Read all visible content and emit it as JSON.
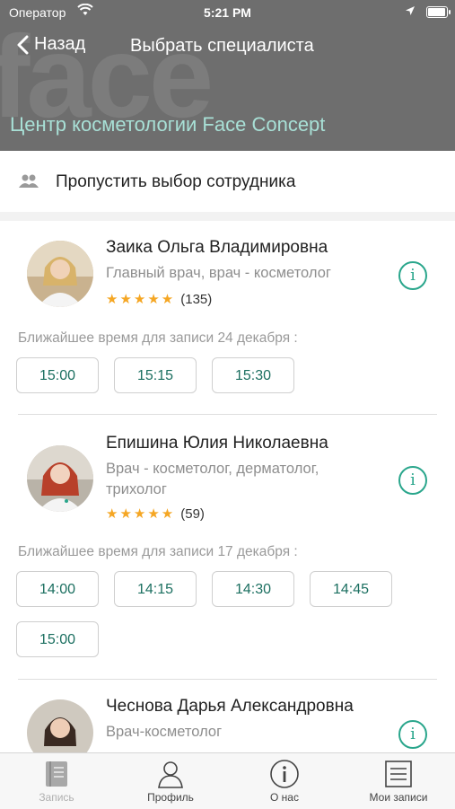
{
  "status_bar": {
    "carrier": "Оператор",
    "time": "5:21 PM"
  },
  "nav": {
    "back_label": "Назад",
    "title": "Выбрать специалиста"
  },
  "organization": {
    "name": "Центр косметологии Face Concept",
    "watermark": "face"
  },
  "skip": {
    "label": "Пропустить выбор сотрудника"
  },
  "specialists": [
    {
      "name": "Заика Ольга Владимировна",
      "role_lines": [
        "Главный врач, врач - косметолог"
      ],
      "stars": "★★★★★",
      "reviews": "(135)",
      "nearest_label": "Ближайшее время для записи 24 декабря :",
      "slots": [
        "15:00",
        "15:15",
        "15:30"
      ]
    },
    {
      "name": "Епишина Юлия Николаевна",
      "role_lines": [
        "Врач - косметолог, дерматолог,",
        "трихолог"
      ],
      "stars": "★★★★★",
      "reviews": "(59)",
      "nearest_label": "Ближайшее время для записи 17 декабря :",
      "slots": [
        "14:00",
        "14:15",
        "14:30",
        "14:45",
        "15:00"
      ]
    },
    {
      "name": "Чеснова Дарья Александровна",
      "role_lines": [
        "Врач-косметолог"
      ]
    }
  ],
  "tabs": [
    {
      "label": "Запись",
      "icon": "book-icon",
      "active": true
    },
    {
      "label": "Профиль",
      "icon": "person-icon"
    },
    {
      "label": "О нас",
      "icon": "info-icon"
    },
    {
      "label": "Мои записи",
      "icon": "list-icon"
    }
  ],
  "colors": {
    "accent": "#2aa68c",
    "slot_text": "#1b6f60",
    "star": "#f5a623",
    "header_bg": "#6e6e6e",
    "org_title": "#a8e0d6"
  }
}
